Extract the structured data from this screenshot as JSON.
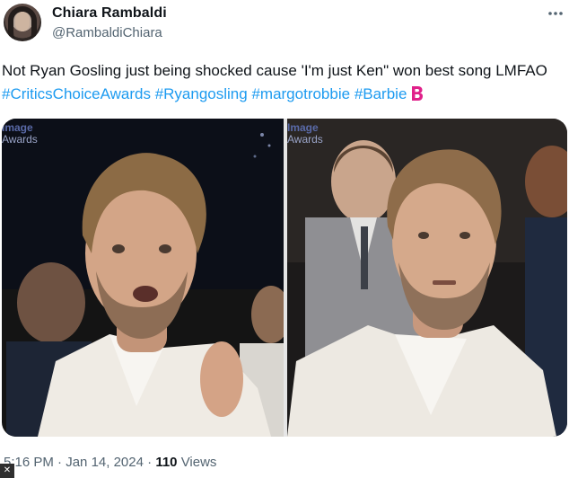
{
  "author": {
    "display_name": "Chiara Rambaldi",
    "handle": "@RambaldiChiara",
    "avatar_icon": "profile-photo"
  },
  "tweet": {
    "text": "Not Ryan Gosling just being shocked cause 'I'm just Ken\" won best song LMFAO",
    "hashtags": [
      "#CriticsChoiceAwards",
      "#Ryangosling",
      "#margotrobbie",
      "#Barbie"
    ],
    "emoji": "barbie-logo-emoji"
  },
  "media": {
    "images": [
      {
        "watermark_line1": "Image",
        "watermark_line2": "Awards"
      },
      {
        "watermark_line1": "Image",
        "watermark_line2": "Awards"
      }
    ]
  },
  "meta": {
    "time": "5:16 PM",
    "separator": "·",
    "date": "Jan 14, 2024",
    "views_count": "110",
    "views_label": "Views"
  },
  "colors": {
    "link": "#1d9bf0",
    "secondary_text": "#536471",
    "primary_text": "#0f1419"
  },
  "icons": {
    "more": "more-horizontal-icon",
    "corner_logo": "x-logo-icon"
  }
}
